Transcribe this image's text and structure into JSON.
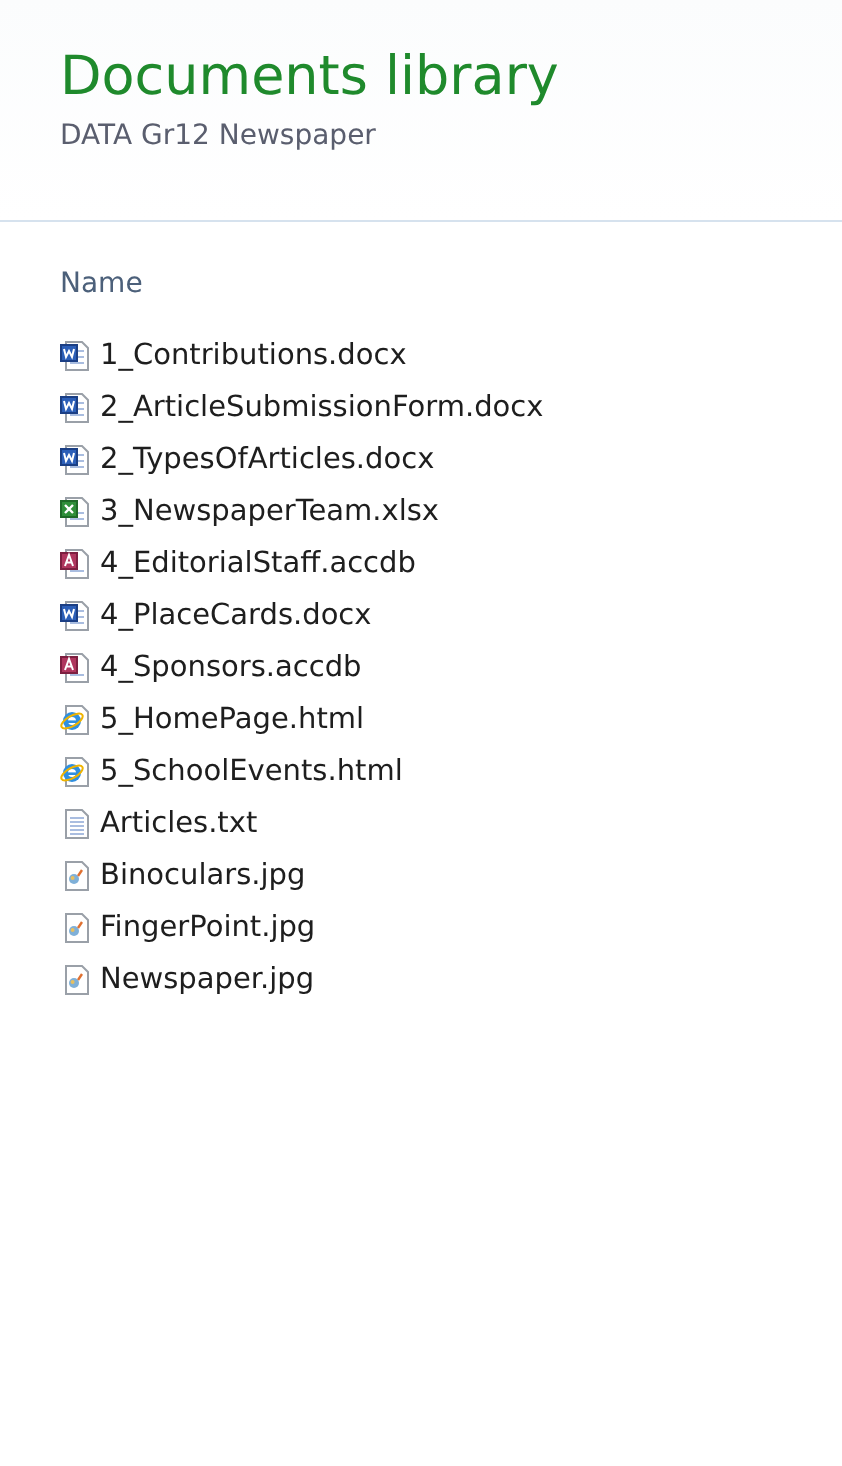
{
  "header": {
    "title": "Documents library",
    "subtitle": "DATA Gr12 Newspaper"
  },
  "columns": [
    "Name"
  ],
  "files": [
    {
      "name": "1_Contributions.docx",
      "kind": "word"
    },
    {
      "name": "2_ArticleSubmissionForm.docx",
      "kind": "word"
    },
    {
      "name": "2_TypesOfArticles.docx",
      "kind": "word"
    },
    {
      "name": "3_NewspaperTeam.xlsx",
      "kind": "excel"
    },
    {
      "name": "4_EditorialStaff.accdb",
      "kind": "access"
    },
    {
      "name": "4_PlaceCards.docx",
      "kind": "word"
    },
    {
      "name": "4_Sponsors.accdb",
      "kind": "access"
    },
    {
      "name": "5_HomePage.html",
      "kind": "html"
    },
    {
      "name": "5_SchoolEvents.html",
      "kind": "html"
    },
    {
      "name": "Articles.txt",
      "kind": "text"
    },
    {
      "name": "Binoculars.jpg",
      "kind": "image"
    },
    {
      "name": "FingerPoint.jpg",
      "kind": "image"
    },
    {
      "name": "Newspaper.jpg",
      "kind": "image"
    }
  ]
}
